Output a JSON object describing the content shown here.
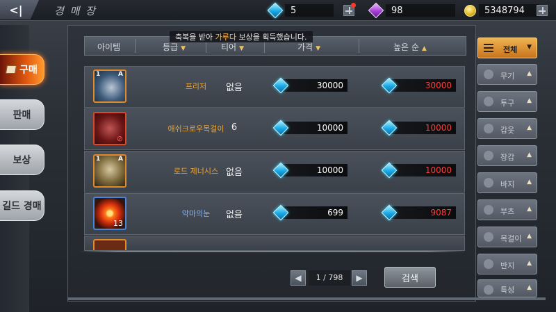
{
  "header": {
    "title": "경 매 장",
    "back_icon": "back-arrow-icon",
    "resources": {
      "blue_gems": "5",
      "purple_gems": "98",
      "gold": "5348794"
    }
  },
  "notice": {
    "prefix": "축복을 받아 ",
    "highlight": "가루다",
    "suffix": " 보상을 획득했습니다."
  },
  "left_tabs": [
    {
      "label": "구매",
      "active": true
    },
    {
      "label": "판매",
      "active": false
    },
    {
      "label": "보상",
      "active": false
    },
    {
      "label": "길드 경매",
      "active": false
    }
  ],
  "columns": {
    "item": "아이템",
    "grade": "등급",
    "tier": "티어",
    "price": "가격",
    "sort": "높은 순"
  },
  "rows": [
    {
      "name": "프리저",
      "tier_level": "1",
      "grade": "A",
      "item_tier": "없음",
      "price": "30000",
      "buyout": "30000",
      "border": "orange"
    },
    {
      "name": "애쉬크로우목걸이",
      "tier_level": "",
      "grade": "",
      "item_tier": "6",
      "price": "10000",
      "buyout": "10000",
      "border": "red"
    },
    {
      "name": "로드 제너시스",
      "tier_level": "1",
      "grade": "A",
      "item_tier": "없음",
      "price": "10000",
      "buyout": "10000",
      "border": "orange"
    },
    {
      "name": "악마의눈",
      "tier_level": "",
      "grade": "",
      "qty": "13",
      "item_tier": "없음",
      "price": "699",
      "buyout": "9087",
      "border": "blue"
    }
  ],
  "pagination": {
    "text": "1 / 798"
  },
  "search_label": "검색",
  "filters": [
    {
      "label": "전체",
      "active": true
    },
    {
      "label": "무기",
      "active": false
    },
    {
      "label": "투구",
      "active": false
    },
    {
      "label": "갑옷",
      "active": false
    },
    {
      "label": "장갑",
      "active": false
    },
    {
      "label": "바지",
      "active": false
    },
    {
      "label": "부츠",
      "active": false
    },
    {
      "label": "목걸이",
      "active": false
    },
    {
      "label": "반지",
      "active": false
    },
    {
      "label": "특성",
      "active": false
    }
  ],
  "colors": {
    "accent": "#e0580f",
    "price_red": "#ff3d3d",
    "item_orange": "#e8a33a"
  }
}
